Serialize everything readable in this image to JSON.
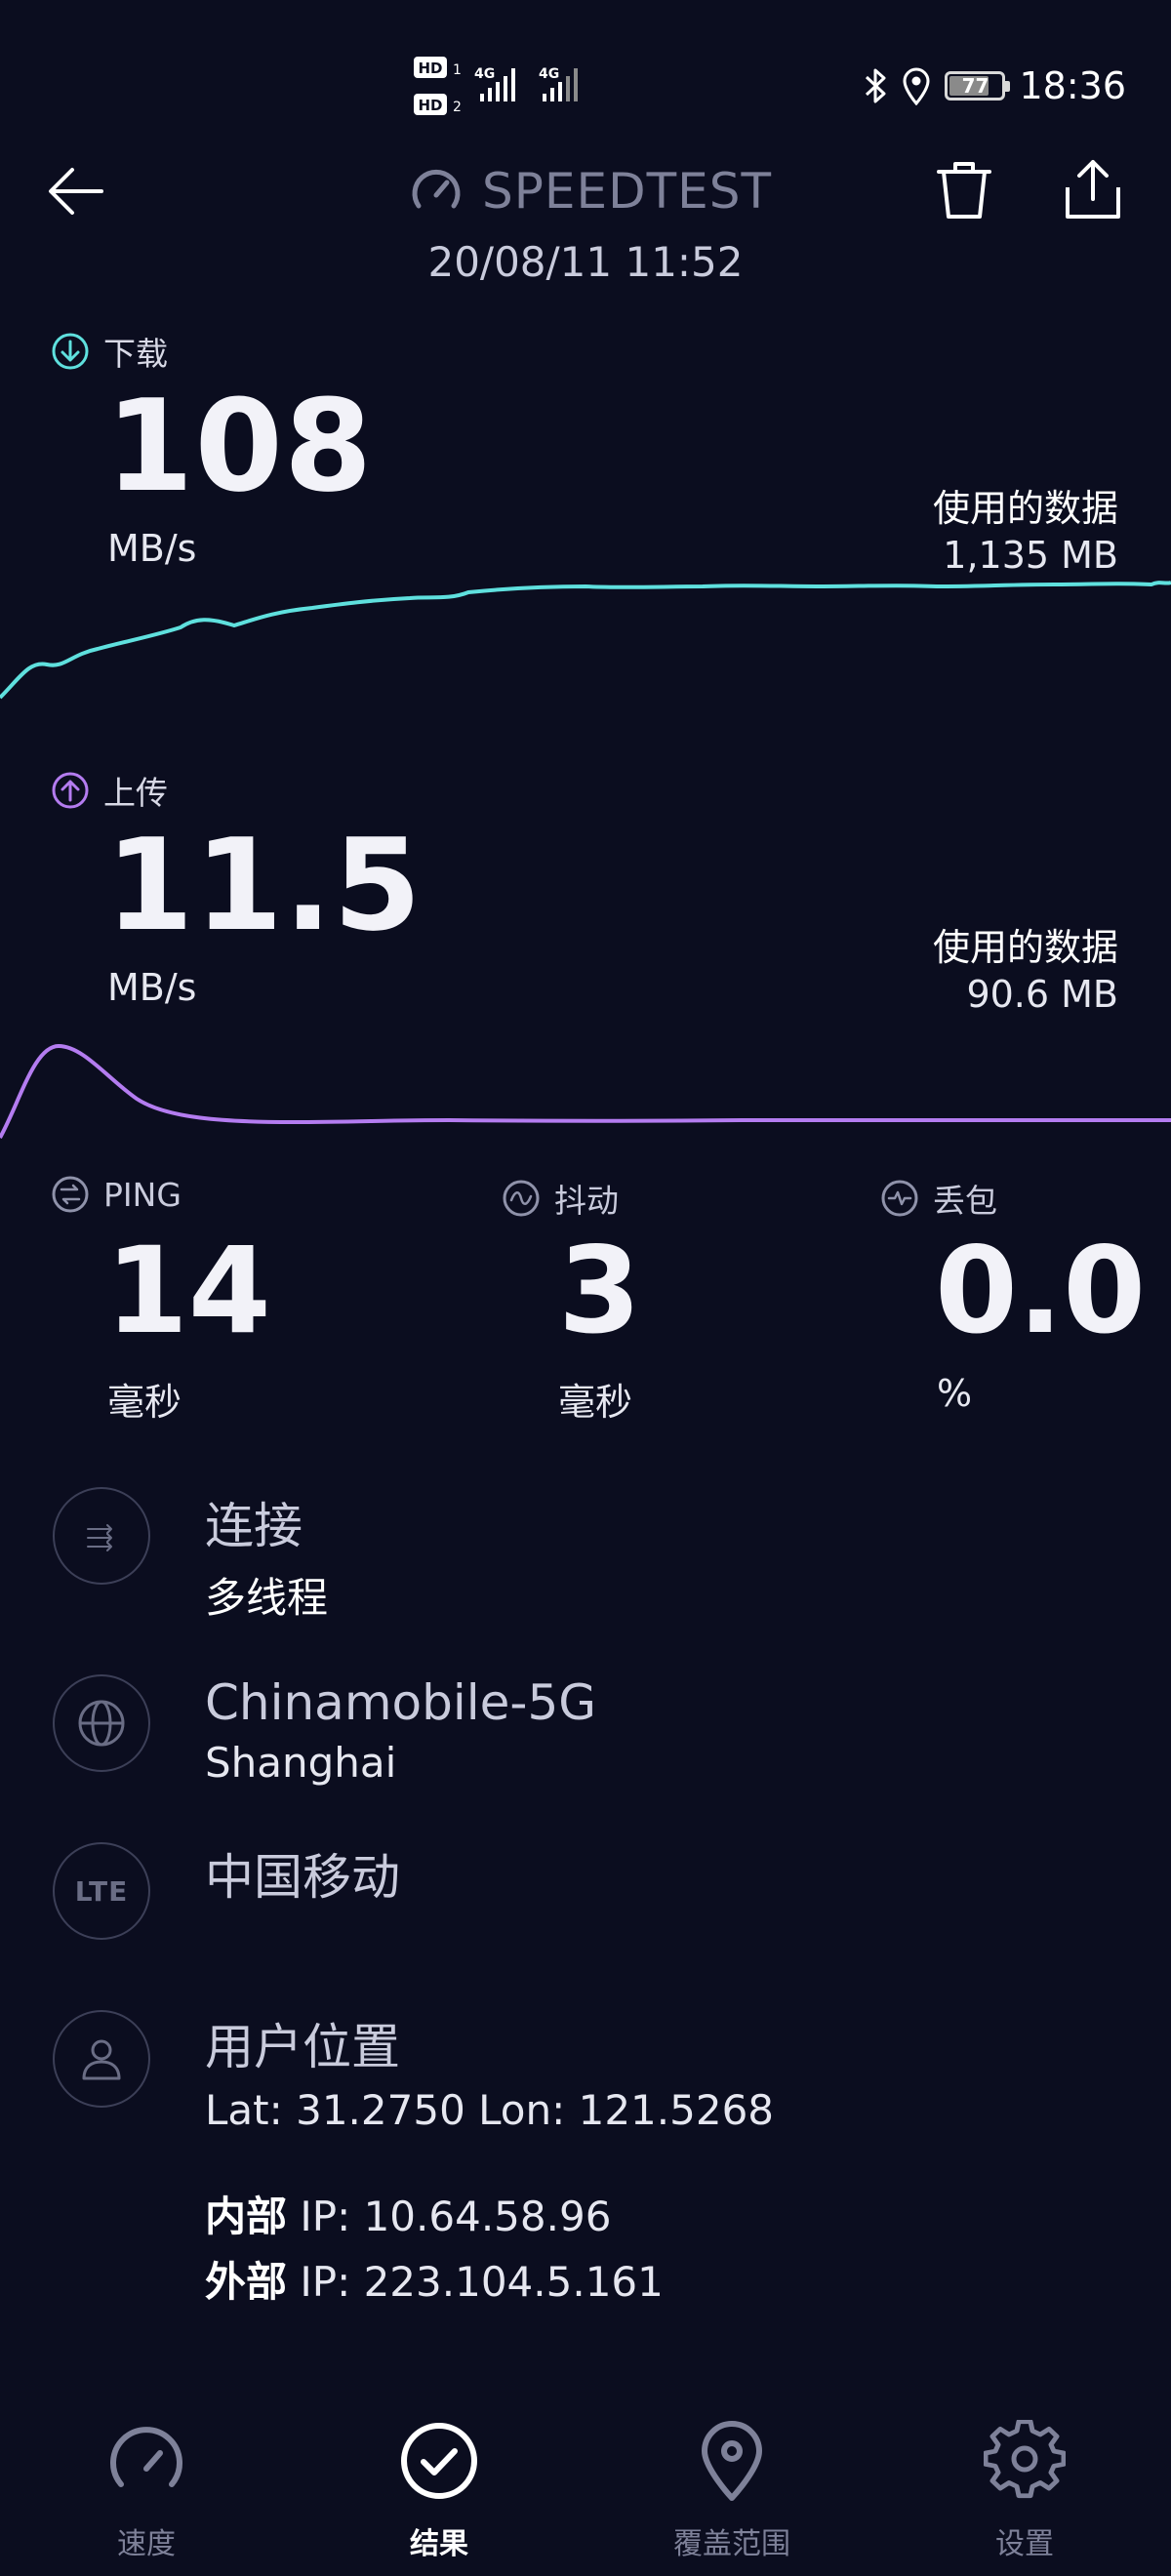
{
  "status_bar": {
    "hd1": "HD",
    "hd2": "HD",
    "net1": "4G",
    "net2": "4G",
    "battery_level": 77,
    "battery": "77",
    "time": "18:36"
  },
  "header": {
    "title": "SPEEDTEST",
    "date": "20/08/11 11:52"
  },
  "download": {
    "label": "下载",
    "value": "108",
    "unit": "MB/s",
    "data_used_label": "使用的数据",
    "data_used_value": "1,135 MB",
    "color": "#5fe0de"
  },
  "upload": {
    "label": "上传",
    "value": "11.5",
    "unit": "MB/s",
    "data_used_label": "使用的数据",
    "data_used_value": "90.6 MB",
    "color": "#b47cf0"
  },
  "ping": {
    "label": "PING",
    "value": "14",
    "unit": "毫秒"
  },
  "jitter": {
    "label": "抖动",
    "value": "3",
    "unit": "毫秒"
  },
  "loss": {
    "label": "丢包",
    "value": "0.0",
    "unit": "%"
  },
  "connection": {
    "title": "连接",
    "subtitle": "多线程"
  },
  "server": {
    "name": "Chinamobile-5G",
    "location": "Shanghai"
  },
  "provider": {
    "badge": "LTE",
    "name": "中国移动"
  },
  "location": {
    "title": "用户位置",
    "coords": "Lat: 31.2750 Lon: 121.5268"
  },
  "ip": {
    "internal_label": "内部",
    "internal_value": "IP: 10.64.58.96",
    "external_label": "外部",
    "external_value": "IP: 223.104.5.161"
  },
  "nav": {
    "speed": "速度",
    "results": "结果",
    "coverage": "覆盖范围",
    "settings": "设置"
  }
}
